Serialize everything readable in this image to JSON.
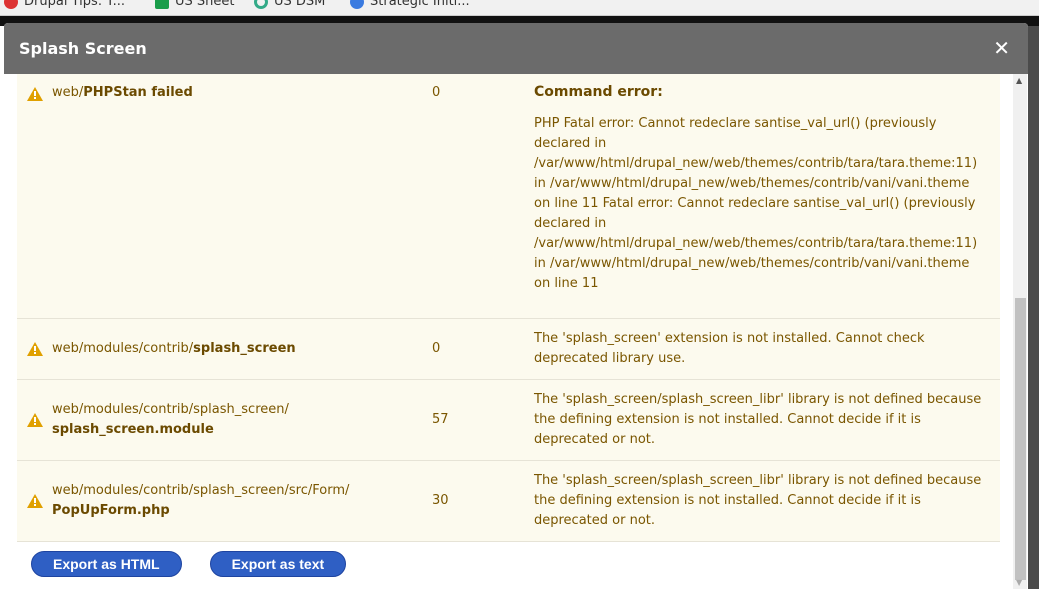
{
  "bookmarks": [
    {
      "label": "Drupal Tips: T...",
      "color": "#d33"
    },
    {
      "label": "US Sheet",
      "color": "#1a9d4a"
    },
    {
      "label": "US DSM",
      "color": "#3a8"
    },
    {
      "label": "Strategic Initi...",
      "color": "#3b7be0"
    }
  ],
  "dialog": {
    "title": "Splash Screen",
    "close": "✕"
  },
  "rows": [
    {
      "path_prefix": "web/",
      "path_bold": "PHPStan failed",
      "count": "0",
      "msg_title": "Command error:",
      "message": "PHP Fatal error: Cannot redeclare santise_val_url() (previously declared in /var/www/html/drupal_new/web/themes/contrib/tara/tara.theme:11) in /var/www/html/drupal_new/web/themes/contrib/vani/vani.theme on line 11 Fatal error: Cannot redeclare santise_val_url() (previously declared in /var/www/html/drupal_new/web/themes/contrib/tara/tara.theme:11) in /var/www/html/drupal_new/web/themes/contrib/vani/vani.theme on line 11"
    },
    {
      "path_prefix": "web/modules/contrib/",
      "path_bold": "splash_screen",
      "count": "0",
      "message": "The 'splash_screen' extension is not installed. Cannot check deprecated library use."
    },
    {
      "path_prefix": "web/modules/contrib/splash_screen/",
      "path_bold": "splash_screen.module",
      "count": "57",
      "message": "The 'splash_screen/splash_screen_libr' library is not defined because the defining extension is not installed. Cannot decide if it is deprecated or not."
    },
    {
      "path_prefix": "web/modules/contrib/splash_screen/src/Form/",
      "path_bold": "PopUpForm.php",
      "count": "30",
      "message": "The 'splash_screen/splash_screen_libr' library is not defined because the defining extension is not installed. Cannot decide if it is deprecated or not."
    }
  ],
  "buttons": {
    "export_html": "Export as HTML",
    "export_text": "Export as text"
  },
  "colors": {
    "warning": "#e0a000",
    "row_bg": "#fcfaee",
    "button": "#2f5fc4"
  }
}
